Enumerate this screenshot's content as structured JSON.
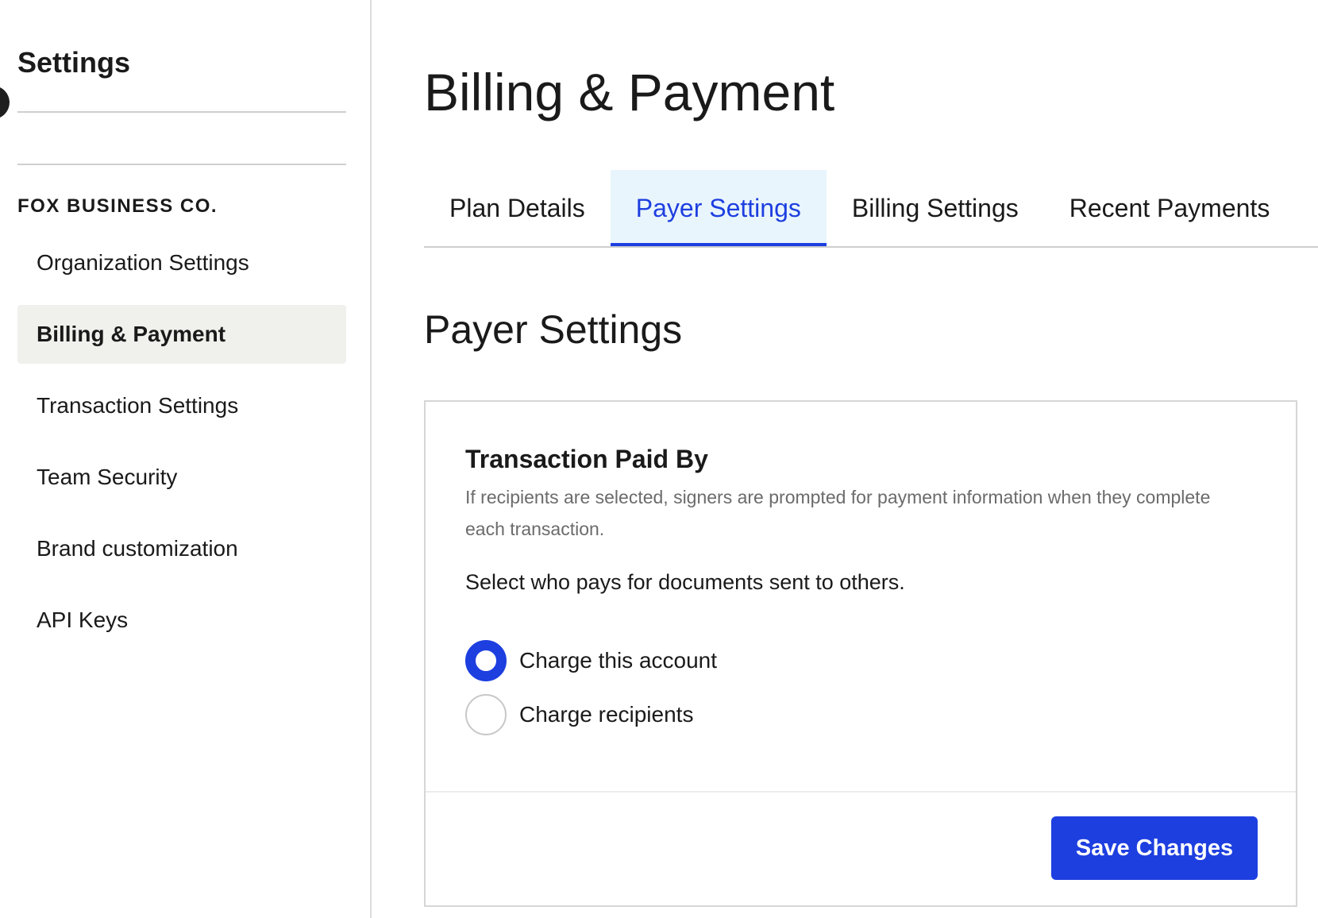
{
  "sidebar": {
    "title": "Settings",
    "org_label": "FOX BUSINESS CO.",
    "items": [
      {
        "label": "Organization Settings",
        "active": false
      },
      {
        "label": "Billing & Payment",
        "active": true
      },
      {
        "label": "Transaction Settings",
        "active": false
      },
      {
        "label": "Team Security",
        "active": false
      },
      {
        "label": "Brand customization",
        "active": false
      },
      {
        "label": "API Keys",
        "active": false
      }
    ]
  },
  "main": {
    "title": "Billing & Payment",
    "tabs": [
      {
        "label": "Plan Details",
        "active": false
      },
      {
        "label": "Payer Settings",
        "active": true
      },
      {
        "label": "Billing Settings",
        "active": false
      },
      {
        "label": "Recent Payments",
        "active": false
      }
    ],
    "section_title": "Payer Settings",
    "card": {
      "heading": "Transaction Paid By",
      "description": "If recipients are selected, signers are prompted for payment information when they complete each transaction.",
      "prompt": "Select who pays for documents sent to others.",
      "options": [
        {
          "label": "Charge this account",
          "checked": true
        },
        {
          "label": "Charge recipients",
          "checked": false
        }
      ],
      "save_label": "Save Changes"
    }
  },
  "colors": {
    "accent": "#1d3fe0",
    "active_tab_bg": "#e9f5fc",
    "active_nav_bg": "#f0f0ec"
  }
}
